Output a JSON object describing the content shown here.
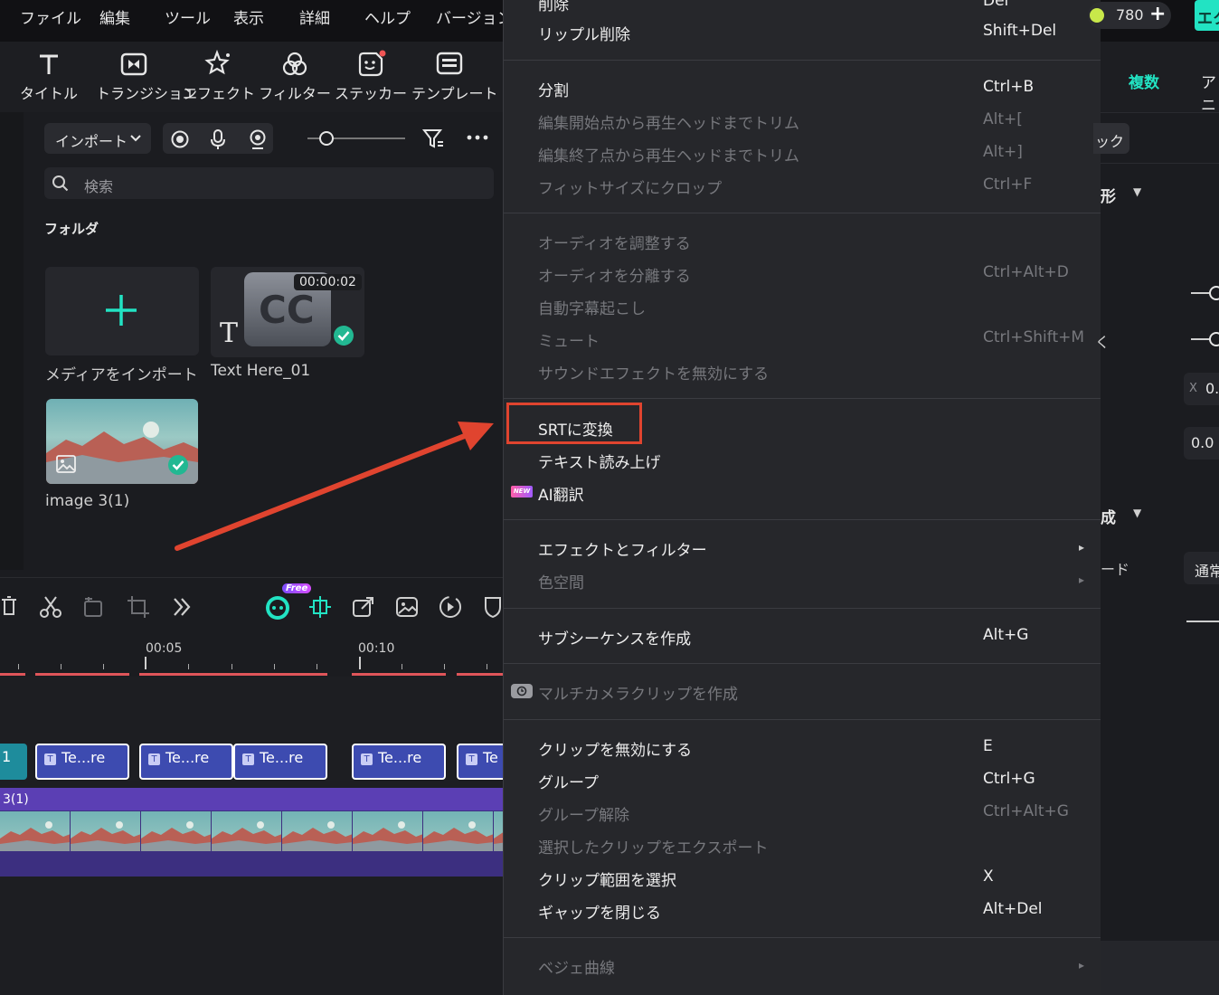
{
  "menubar": {
    "items": [
      "ファイル",
      "編集",
      "ツール",
      "表示",
      "詳細",
      "ヘルプ",
      "バージョン"
    ],
    "credits": "780",
    "export_label": "エク"
  },
  "toolbar": {
    "tools": [
      "タイトル",
      "トランジション",
      "エフェクト",
      "フィルター",
      "ステッカー",
      "テンプレート"
    ]
  },
  "media": {
    "import_label": "インポート",
    "search_placeholder": "検索",
    "folder_label": "フォルダ",
    "import_tile_label": "メディアをインポート",
    "title_clip": {
      "duration": "00:00:02",
      "label": "Text Here_01",
      "cc": "CC",
      "t": "T"
    },
    "image_clip": {
      "label": "image 3(1)"
    }
  },
  "timeline": {
    "free_badge": "Free",
    "ruler": [
      "00:05",
      "00:10"
    ],
    "clips": [
      "Te...re",
      "Te...re",
      "Te...re",
      "Te...re",
      "Te"
    ],
    "first_clip_label": "1",
    "track_label": "3(1)"
  },
  "context_menu": {
    "top_cut": {
      "label": "削除",
      "shortcut": "Del"
    },
    "ripple": {
      "label": "リップル削除",
      "shortcut": "Shift+Del"
    },
    "g1": [
      {
        "label": "分割",
        "shortcut": "Ctrl+B",
        "enabled": true
      },
      {
        "label": "編集開始点から再生ヘッドまでトリム",
        "shortcut": "Alt+[",
        "enabled": false
      },
      {
        "label": "編集終了点から再生ヘッドまでトリム",
        "shortcut": "Alt+]",
        "enabled": false
      },
      {
        "label": "フィットサイズにクロップ",
        "shortcut": "Ctrl+F",
        "enabled": false
      }
    ],
    "g2": [
      {
        "label": "オーディオを調整する",
        "shortcut": "",
        "enabled": false
      },
      {
        "label": "オーディオを分離する",
        "shortcut": "Ctrl+Alt+D",
        "enabled": false
      },
      {
        "label": "自動字幕起こし",
        "shortcut": "",
        "enabled": false
      },
      {
        "label": "ミュート",
        "shortcut": "Ctrl+Shift+M",
        "enabled": false
      },
      {
        "label": "サウンドエフェクトを無効にする",
        "shortcut": "",
        "enabled": false
      }
    ],
    "g3": [
      {
        "label": "SRTに変換",
        "enabled": true
      },
      {
        "label": "テキスト読み上げ",
        "enabled": true
      },
      {
        "label": "AI翻訳",
        "enabled": true,
        "badge": "NEW"
      }
    ],
    "g4": [
      {
        "label": "エフェクトとフィルター",
        "enabled": true
      },
      {
        "label": "色空間",
        "enabled": false
      }
    ],
    "subseq": {
      "label": "サブシーケンスを作成",
      "shortcut": "Alt+G"
    },
    "multicam": {
      "label": "マルチカメラクリップを作成"
    },
    "g5": [
      {
        "label": "クリップを無効にする",
        "shortcut": "E",
        "enabled": true
      },
      {
        "label": "グループ",
        "shortcut": "Ctrl+G",
        "enabled": true
      },
      {
        "label": "グループ解除",
        "shortcut": "Ctrl+Alt+G",
        "enabled": false
      },
      {
        "label": "選択したクリップをエクスポート",
        "shortcut": "",
        "enabled": false
      },
      {
        "label": "クリップ範囲を選択",
        "shortcut": "X",
        "enabled": true
      },
      {
        "label": "ギャップを閉じる",
        "shortcut": "Alt+Del",
        "enabled": true
      }
    ],
    "bezier": {
      "label": "ベジェ曲線"
    }
  },
  "right_panel": {
    "tab_multi": "複数",
    "tab_anim": "アニ",
    "chip": "ック",
    "section1": "形",
    "section2": "成",
    "x_label": "X",
    "x_value": "0.",
    "value2": "0.0",
    "mode_label": "ード",
    "mode_value": "通常",
    "frag1": "く",
    "frag2": " "
  },
  "colors": {
    "accent": "#22e3c3",
    "highlight": "#e0442f",
    "clip": "#3d4bb0",
    "track": "#5b3fb4"
  }
}
